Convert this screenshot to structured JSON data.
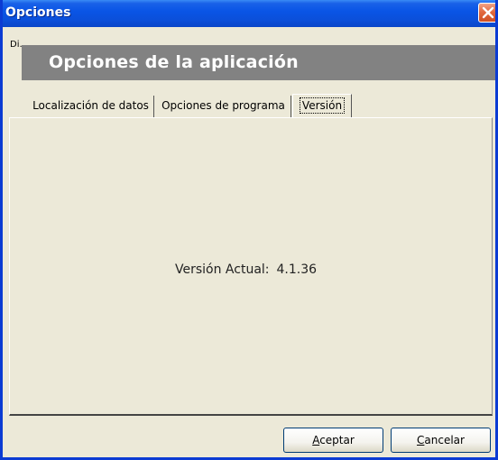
{
  "window": {
    "title": "Opciones",
    "fragment_label": "Di..."
  },
  "header": {
    "banner_title": "Opciones de la aplicación"
  },
  "tabs": [
    {
      "label": "Localización de datos",
      "active": false
    },
    {
      "label": "Opciones de programa",
      "active": false
    },
    {
      "label": "Versión",
      "active": true
    }
  ],
  "version_panel": {
    "label": "Versión Actual:",
    "value": "4.1.36"
  },
  "buttons": {
    "accept": {
      "accel": "A",
      "rest": "ceptar"
    },
    "cancel": {
      "accel": "C",
      "rest": "ancelar"
    }
  },
  "colors": {
    "titlebar": "#0a55e6",
    "window_bg": "#ece9d8",
    "banner_bg": "#828282",
    "close_button": "#e26a3f"
  },
  "icons": {
    "close": "close-icon"
  }
}
